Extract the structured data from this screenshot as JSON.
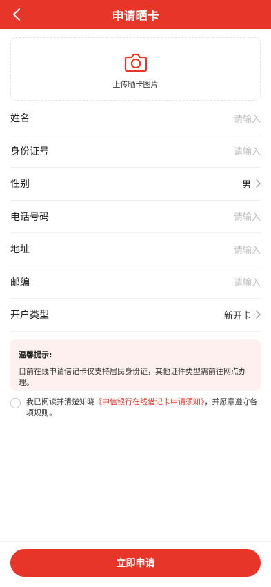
{
  "header": {
    "title": "申请晒卡",
    "back_icon": "chevron-left-icon"
  },
  "upload": {
    "label": "上传晒卡图片",
    "icon": "camera-icon"
  },
  "form": {
    "name": {
      "label": "姓名",
      "placeholder": "请输入"
    },
    "id_number": {
      "label": "身份证号",
      "placeholder": "请输入"
    },
    "gender": {
      "label": "性别",
      "value": "男"
    },
    "phone": {
      "label": "电话号码",
      "placeholder": "请输入"
    },
    "address": {
      "label": "地址",
      "placeholder": "请输入"
    },
    "postcode": {
      "label": "邮编",
      "placeholder": "请输入"
    },
    "account_type": {
      "label": "开户类型",
      "value": "新开卡"
    }
  },
  "tip": {
    "title": "温馨提示:",
    "content": "目前在线申请借记卡仅支持居民身份证，其他证件类型需前往网点办理。"
  },
  "agreement": {
    "prefix": "我已阅读并清楚知晓",
    "link": "《中信银行在线借记卡申请须知》",
    "suffix": "，并愿意遵守各项规则。"
  },
  "submit": {
    "label": "立即申请"
  },
  "colors": {
    "accent": "#e8352a",
    "tip_bg": "#fdf0ef",
    "placeholder": "#bdbdbd"
  }
}
